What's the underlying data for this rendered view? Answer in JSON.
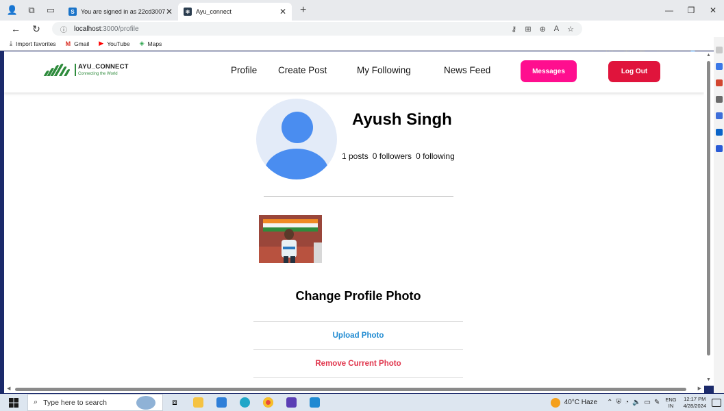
{
  "browser": {
    "tabs": [
      {
        "title": "You are signed in as 22cd3007",
        "favicon": "S"
      },
      {
        "title": "Ayu_connect"
      }
    ],
    "url_host": "localhost",
    "url_path": ":3000/profile",
    "favorites": [
      {
        "label": "Import favorites",
        "icon": "import-icon"
      },
      {
        "label": "Gmail",
        "icon": "gmail-icon"
      },
      {
        "label": "YouTube",
        "icon": "youtube-icon"
      },
      {
        "label": "Maps",
        "icon": "maps-icon"
      }
    ]
  },
  "app": {
    "logo_title": "AYU_CONNECT",
    "logo_subtitle": "Connecting the World",
    "nav": {
      "profile": "Profile",
      "create_post": "Create Post",
      "my_following": "My Following",
      "news_feed": "News Feed"
    },
    "messages_button": "Messages",
    "logout_button": "Log Out",
    "colors": {
      "messages": "#ff0e8f",
      "logout": "#e0143c",
      "upload": "#1f8ad1",
      "remove": "#e0344b"
    }
  },
  "profile": {
    "name": "Ayush Singh",
    "posts": "1 posts",
    "followers": "0 followers",
    "following": "0 following"
  },
  "photo_modal": {
    "title": "Change Profile Photo",
    "upload": "Upload Photo",
    "remove": "Remove Current Photo"
  },
  "taskbar": {
    "search_placeholder": "Type here to search",
    "weather": "40°C  Haze",
    "lang_line1": "ENG",
    "lang_line2": "IN",
    "time": "12:17 PM",
    "date": "4/28/2024"
  }
}
